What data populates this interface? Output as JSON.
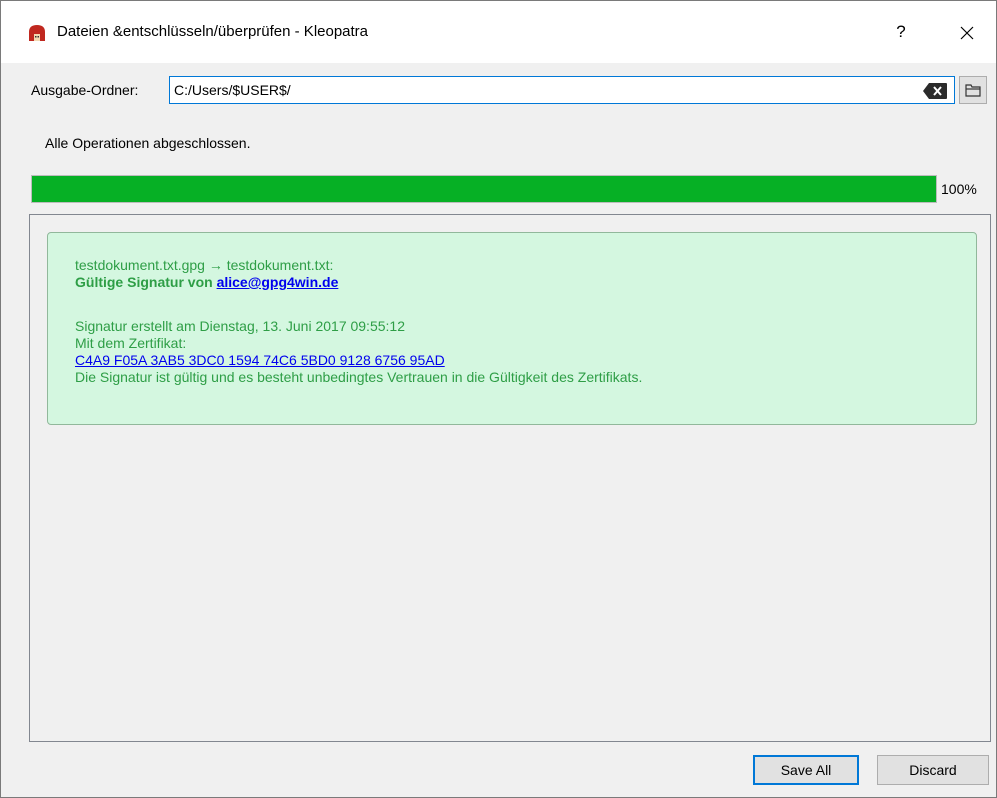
{
  "window": {
    "title": "Dateien &entschlüsseln/überprüfen - Kleopatra",
    "help_label": "?",
    "icon": "kleopatra-app-icon",
    "close_icon": "close-icon"
  },
  "output": {
    "label": "Ausgabe-Ordner:",
    "value": "C:/Users/$USER$/",
    "clear_icon": "clear-input-icon",
    "browse_icon": "folder-icon"
  },
  "status": {
    "text": "Alle Operationen abgeschlossen."
  },
  "progress": {
    "percent": 100,
    "label": "100%",
    "color": "#06b025"
  },
  "result": {
    "file_line": "testdokument.txt.gpg → testdokument.txt:",
    "signature_prefix": "Gültige Signatur von ",
    "signer": "alice@gpg4win.de",
    "created": "Signatur erstellt am Dienstag, 13. Juni 2017 09:55:12",
    "cert_label": "Mit dem Zertifikat:",
    "fingerprint": "C4A9 F05A 3AB5 3DC0 1594 74C6 5BD0 9128 6756 95AD",
    "validity": "Die Signatur ist gültig und es besteht unbedingtes Vertrauen in die Gültigkeit des Zertifikats.",
    "background_color": "#d4f7e0",
    "text_color": "#2e9e46"
  },
  "buttons": {
    "save_all": "Save All",
    "discard": "Discard"
  }
}
